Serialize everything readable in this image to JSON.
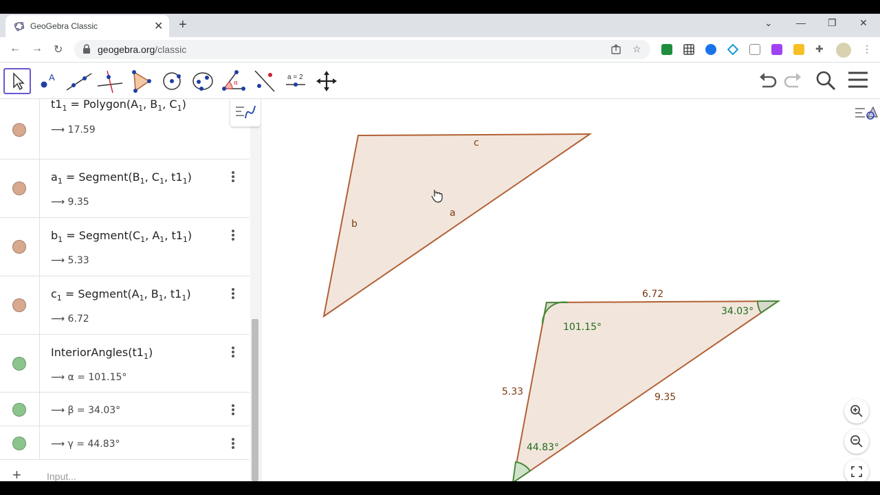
{
  "browser": {
    "tab_title": "GeoGebra Classic",
    "tab_close": "✕",
    "new_tab": "+",
    "url_host": "geogebra.org",
    "url_path": "/classic",
    "win_min": "—",
    "win_restore": "❐",
    "win_close": "✕",
    "win_down": "⌄"
  },
  "algebra": {
    "rows": [
      {
        "name": "t1",
        "sub": "1",
        "def": "Polygon(A",
        "args": [
          "1",
          "B",
          "1",
          "C",
          "1"
        ],
        "value": "17.59"
      },
      {
        "name": "a",
        "sub": "1",
        "value": "9.35"
      },
      {
        "name": "b",
        "sub": "1",
        "value": "5.33"
      },
      {
        "name": "c",
        "sub": "1",
        "value": "6.72"
      },
      {
        "value": "101.15°"
      },
      {
        "value": "34.03°"
      },
      {
        "value": "44.83°"
      }
    ],
    "input_placeholder": "Input..."
  },
  "graphics": {
    "labels_top": {
      "a": "a",
      "b": "b",
      "c": "c"
    },
    "side_top": "6.72",
    "side_left": "5.33",
    "side_right": "9.35",
    "angle_a": "101.15°",
    "angle_b": "34.03°",
    "angle_c": "44.83°"
  },
  "colors": {
    "polygon_fill": "#f2e6dc",
    "polygon_stroke": "#b25f33",
    "angle_fill": "#cfe3c8",
    "angle_stroke": "#4a8a3a",
    "label_brown": "#7a3a12",
    "label_green": "#1e6b1e"
  }
}
